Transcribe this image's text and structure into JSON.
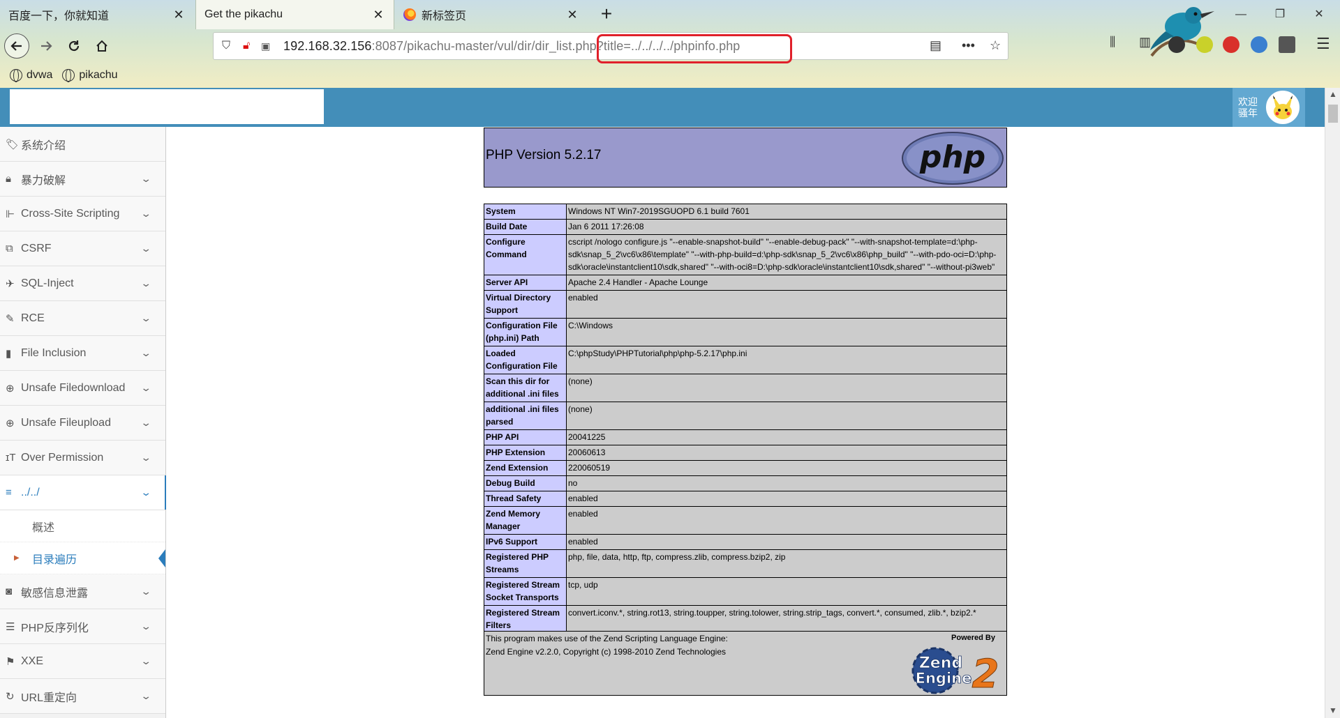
{
  "browser": {
    "tabs": [
      {
        "title": "百度一下，你就知道",
        "active": false
      },
      {
        "title": "Get the pikachu",
        "active": true
      },
      {
        "title": "新标签页",
        "active": false
      }
    ],
    "url": {
      "host": "192.168.32.156",
      "rest_dim": ":8087",
      "path": "/pikachu-master/vul/dir/dir_list.php?title=../../../../phpinfo.php"
    },
    "bookmarks": [
      "dvwa",
      "pikachu"
    ],
    "icons": {
      "back": "back-arrow-icon",
      "forward": "forward-arrow-icon",
      "reload": "reload-icon",
      "home": "home-icon",
      "reader": "reader-view-icon",
      "more": "more-dots-icon",
      "star": "bookmark-star-icon"
    }
  },
  "header": {
    "welcome": "欢迎\n骚年"
  },
  "sidebar": {
    "items": [
      {
        "label": "系统介绍",
        "icon": "tag-icon",
        "chevron": false
      },
      {
        "label": "暴力破解",
        "icon": "lock-icon",
        "chevron": true
      },
      {
        "label": "Cross-Site Scripting",
        "icon": "sitemap-icon",
        "chevron": true
      },
      {
        "label": "CSRF",
        "icon": "external-link-icon",
        "chevron": true
      },
      {
        "label": "SQL-Inject",
        "icon": "fighter-jet-icon",
        "chevron": true
      },
      {
        "label": "RCE",
        "icon": "pencil-icon",
        "chevron": true
      },
      {
        "label": "File Inclusion",
        "icon": "file-icon",
        "chevron": true
      },
      {
        "label": "Unsafe Filedownload",
        "icon": "download-circle-icon",
        "chevron": true
      },
      {
        "label": "Unsafe Fileupload",
        "icon": "upload-circle-icon",
        "chevron": true
      },
      {
        "label": "Over Permission",
        "icon": "text-height-icon",
        "chevron": true
      },
      {
        "label": "../../",
        "icon": "align-left-icon",
        "chevron": true,
        "open": true,
        "children": [
          {
            "label": "概述",
            "active": false
          },
          {
            "label": "目录遍历",
            "active": true
          }
        ]
      },
      {
        "label": "敏感信息泄露",
        "icon": "camera-icon",
        "chevron": true
      },
      {
        "label": "PHP反序列化",
        "icon": "list-icon",
        "chevron": true
      },
      {
        "label": "XXE",
        "icon": "flag-icon",
        "chevron": true
      },
      {
        "label": "URL重定向",
        "icon": "refresh-icon",
        "chevron": true
      }
    ]
  },
  "phpinfo": {
    "version": "PHP Version 5.2.17",
    "rows": [
      [
        "System",
        "Windows NT Win7-2019SGUOPD 6.1 build 7601"
      ],
      [
        "Build Date",
        "Jan 6 2011 17:26:08"
      ],
      [
        "Configure Command",
        "cscript /nologo configure.js \"--enable-snapshot-build\" \"--enable-debug-pack\" \"--with-snapshot-template=d:\\php-sdk\\snap_5_2\\vc6\\x86\\template\" \"--with-php-build=d:\\php-sdk\\snap_5_2\\vc6\\x86\\php_build\" \"--with-pdo-oci=D:\\php-sdk\\oracle\\instantclient10\\sdk,shared\" \"--with-oci8=D:\\php-sdk\\oracle\\instantclient10\\sdk,shared\" \"--without-pi3web\""
      ],
      [
        "Server API",
        "Apache 2.4 Handler - Apache Lounge"
      ],
      [
        "Virtual Directory Support",
        "enabled"
      ],
      [
        "Configuration File (php.ini) Path",
        "C:\\Windows"
      ],
      [
        "Loaded Configuration File",
        "C:\\phpStudy\\PHPTutorial\\php\\php-5.2.17\\php.ini"
      ],
      [
        "Scan this dir for additional .ini files",
        "(none)"
      ],
      [
        "additional .ini files parsed",
        "(none)"
      ],
      [
        "PHP API",
        "20041225"
      ],
      [
        "PHP Extension",
        "20060613"
      ],
      [
        "Zend Extension",
        "220060519"
      ],
      [
        "Debug Build",
        "no"
      ],
      [
        "Thread Safety",
        "enabled"
      ],
      [
        "Zend Memory Manager",
        "enabled"
      ],
      [
        "IPv6 Support",
        "enabled"
      ],
      [
        "Registered PHP Streams",
        "php, file, data, http, ftp, compress.zlib, compress.bzip2, zip"
      ],
      [
        "Registered Stream Socket Transports",
        "tcp, udp"
      ],
      [
        "Registered Stream Filters",
        "convert.iconv.*, string.rot13, string.toupper, string.tolower, string.strip_tags, convert.*, consumed, zlib.*, bzip2.*"
      ]
    ],
    "footer_line1": "This program makes use of the Zend Scripting Language Engine:",
    "footer_line2": "Zend Engine v2.2.0, Copyright (c) 1998-2010 Zend Technologies",
    "powered_by": "Powered By",
    "php_logo_text": "php",
    "zend_logo_text": [
      "Zend",
      "Engine",
      "2"
    ]
  },
  "colors": {
    "header_blue": "#438eb9",
    "php_purple": "#9999cc",
    "php_key": "#ccccff",
    "php_value": "#cccccc",
    "url_highlight": "#e0202a"
  }
}
